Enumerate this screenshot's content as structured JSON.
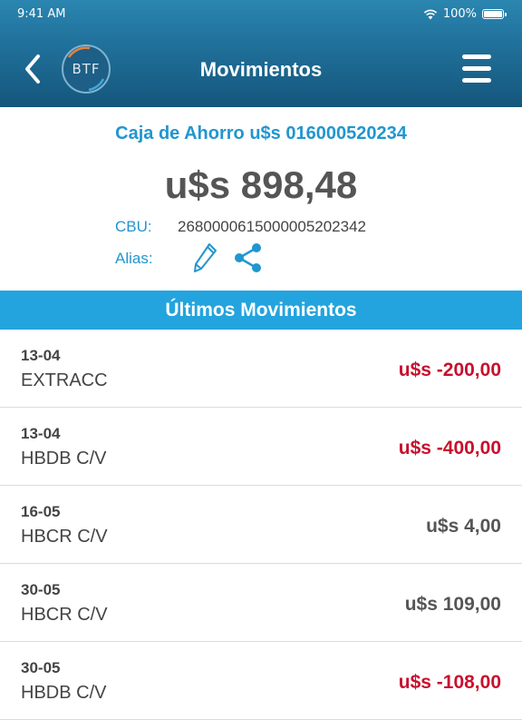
{
  "status_bar": {
    "time": "9:41 AM",
    "battery": "100%"
  },
  "header": {
    "title": "Movimientos",
    "logo_text": "BTF",
    "back_icon": "chevron-left-icon",
    "menu_icon": "hamburger-menu-icon"
  },
  "account": {
    "line": "Caja de Ahorro  u$s  016000520234",
    "balance": "u$s 898,48",
    "cbu_label": "CBU:",
    "cbu_value": "2680000615000005202342",
    "alias_label": "Alias:"
  },
  "section_title": "Últimos Movimientos",
  "colors": {
    "header_blue": "#1f6f99",
    "section_blue": "#23a4de",
    "accent_blue": "#2196cf",
    "negative_red": "#c8102e"
  },
  "movements": [
    {
      "date": "13-04",
      "description": "EXTRACC",
      "amount": "u$s -200,00"
    },
    {
      "date": "13-04",
      "description": "HBDB C/V",
      "amount": "u$s -400,00"
    },
    {
      "date": "16-05",
      "description": "HBCR C/V",
      "amount": "u$s 4,00"
    },
    {
      "date": "30-05",
      "description": "HBCR C/V",
      "amount": "u$s 109,00"
    },
    {
      "date": "30-05",
      "description": "HBDB C/V",
      "amount": "u$s -108,00"
    }
  ]
}
